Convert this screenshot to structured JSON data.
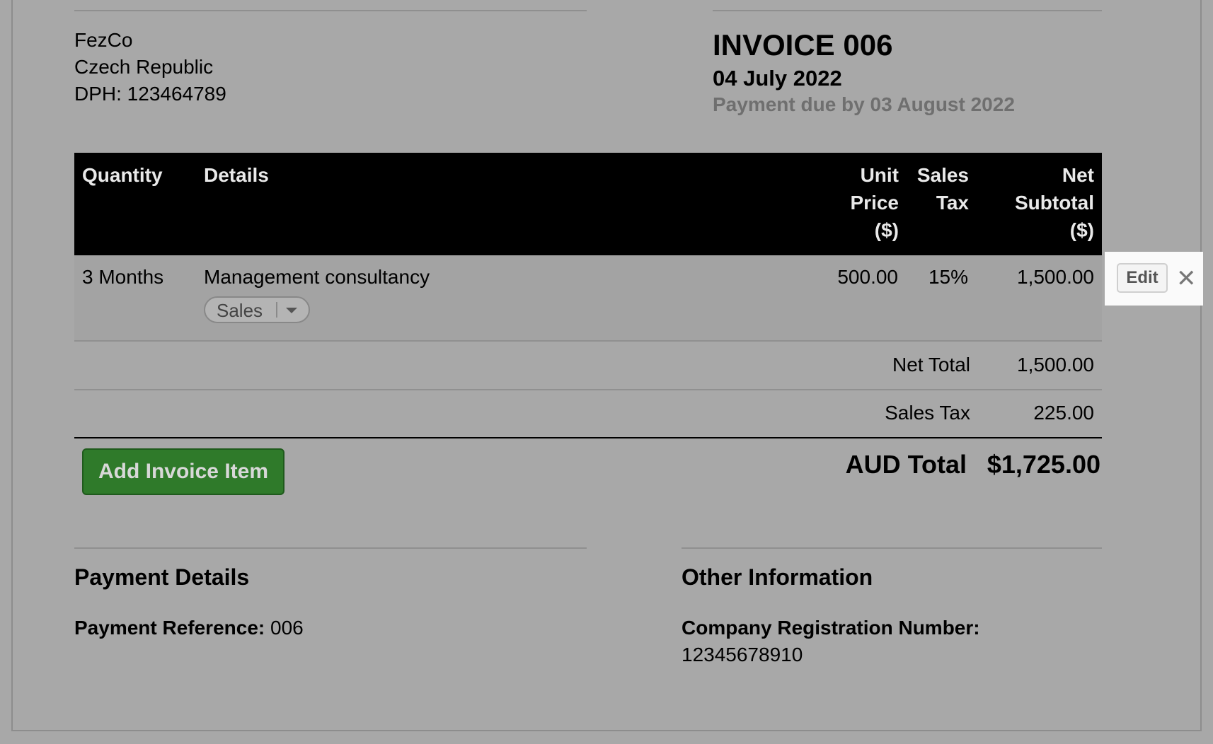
{
  "company": {
    "name": "FezCo",
    "country": "Czech Republic",
    "tax_id": "DPH: 123464789"
  },
  "invoice": {
    "title": "INVOICE 006",
    "date": "04 July 2022",
    "due": "Payment due by 03 August 2022"
  },
  "table": {
    "headers": {
      "quantity": "Quantity",
      "details": "Details",
      "unit_price": [
        "Unit",
        "Price",
        "($)"
      ],
      "sales_tax": [
        "Sales",
        "Tax"
      ],
      "net_subtotal": [
        "Net",
        "Subtotal",
        "($)"
      ]
    },
    "rows": [
      {
        "quantity": "3 Months",
        "details": "Management consultancy",
        "category": "Sales",
        "unit_price": "500.00",
        "sales_tax": "15%",
        "net_subtotal": "1,500.00"
      }
    ],
    "row_actions": {
      "edit_label": "Edit",
      "remove_glyph": "✕"
    }
  },
  "summary": {
    "net_total_label": "Net Total",
    "net_total": "1,500.00",
    "sales_tax_label": "Sales Tax",
    "sales_tax": "225.00",
    "total_label": "AUD Total",
    "total": "$1,725.00"
  },
  "buttons": {
    "add_item": "Add Invoice Item"
  },
  "payment_details": {
    "title": "Payment Details",
    "reference_label": "Payment Reference:",
    "reference_value": "006"
  },
  "other_information": {
    "title": "Other Information",
    "registration_label": "Company Registration Number:",
    "registration_value": "12345678910"
  },
  "colors": {
    "background": "#a8a8a8",
    "header_bg": "#000000",
    "add_button": "#2f7a2a",
    "muted_text": "#6f6f6f"
  }
}
